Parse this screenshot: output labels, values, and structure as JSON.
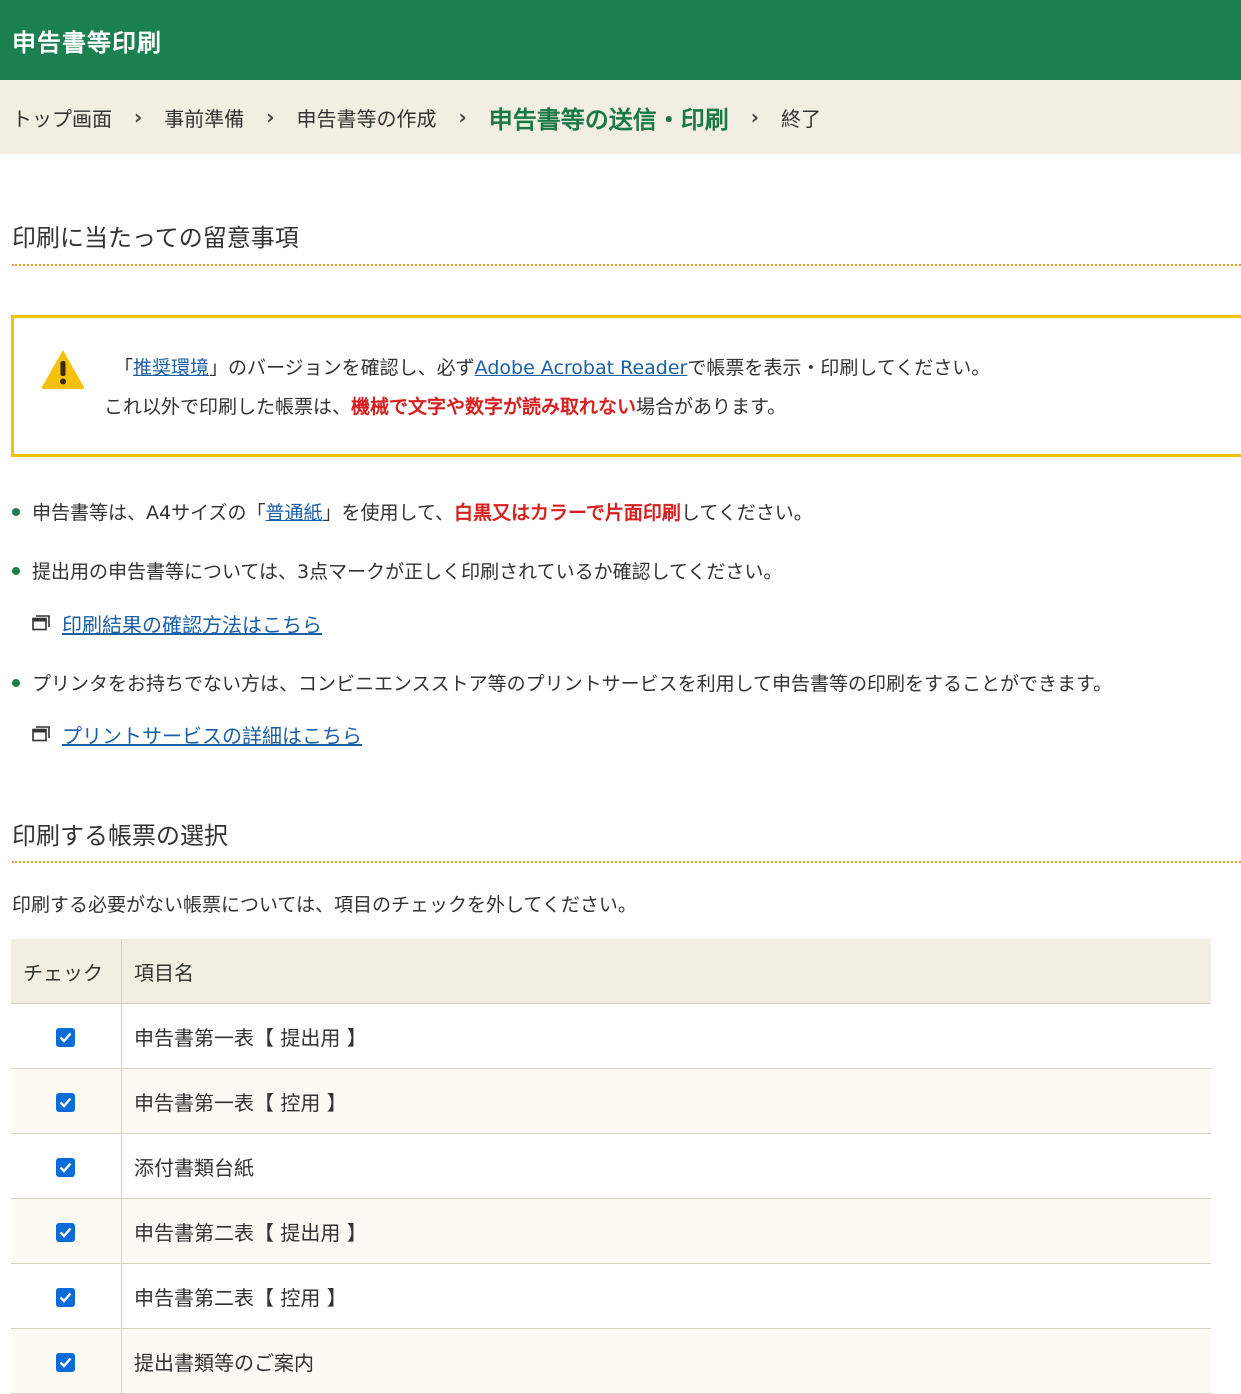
{
  "header": {
    "title": "申告書等印刷"
  },
  "breadcrumb": [
    {
      "label": "トップ画面",
      "current": false
    },
    {
      "label": "事前準備",
      "current": false
    },
    {
      "label": "申告書等の作成",
      "current": false
    },
    {
      "label": "申告書等の送信・印刷",
      "current": true
    },
    {
      "label": "終了",
      "current": false
    }
  ],
  "breadcrumb_separator": "›",
  "notes_section": {
    "title": "印刷に当たっての留意事項",
    "notice": {
      "line1": {
        "open_bracket": "「",
        "env_link": "推奨環境",
        "mid": "」のバージョンを確認し、必ず",
        "acrobat_link": "Adobe Acrobat Reader",
        "tail": "で帳票を表示・印刷してください。"
      },
      "line2": {
        "prefix": "これ以外で印刷した帳票は、",
        "emphasis": "機械で文字や数字が読み取れない",
        "suffix": "場合があります。"
      }
    },
    "bullet1": {
      "prefix": "申告書等は、A4サイズの「",
      "link": "普通紙",
      "mid": "」を使用して、",
      "emphasis": "白黒又はカラーで片面印刷",
      "suffix": "してください。"
    },
    "bullet2": {
      "text": "提出用の申告書等については、3点マークが正しく印刷されているか確認してください。"
    },
    "link_print_check": "印刷結果の確認方法はこちら",
    "bullet3": {
      "text": "プリンタをお持ちでない方は、コンビニエンスストア等のプリントサービスを利用して申告書等の印刷をすることができます。"
    },
    "link_print_service": "プリントサービスの詳細はこちら"
  },
  "select_section": {
    "title": "印刷する帳票の選択",
    "intro": "印刷する必要がない帳票については、項目のチェックを外してください。",
    "table": {
      "headers": {
        "check": "チェック",
        "item": "項目名"
      },
      "rows": [
        {
          "name": "申告書第一表【 提出用 】",
          "checked": true
        },
        {
          "name": "申告書第一表【 控用 】",
          "checked": true
        },
        {
          "name": "添付書類台紙",
          "checked": true
        },
        {
          "name": "申告書第二表【 提出用 】",
          "checked": true
        },
        {
          "name": "申告書第二表【 控用 】",
          "checked": true
        },
        {
          "name": "提出書類等のご案内",
          "checked": true
        }
      ]
    }
  },
  "colors": {
    "header_bg": "#1a8050",
    "accent_text": "#1a7a46",
    "warning_border": "#eec400",
    "emphasis_red": "#d62020",
    "link": "#1a5fa8",
    "checkbox": "#0b6cd9"
  }
}
